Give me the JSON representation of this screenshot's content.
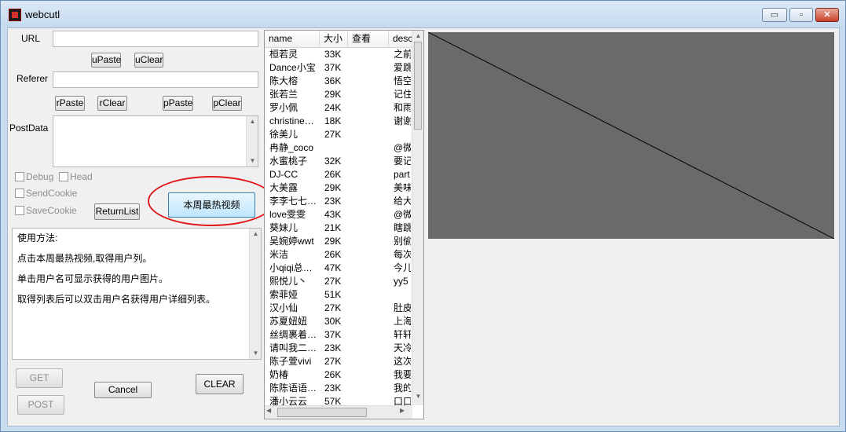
{
  "window": {
    "title": "webcutl"
  },
  "titlebar_buttons": {
    "minimize": "▭",
    "maximize": "▫",
    "close": "✕"
  },
  "form": {
    "url_label": "URL",
    "url_value": "",
    "upaste": "uPaste",
    "uclear": "uClear",
    "referer_label": "Referer",
    "referer_value": "",
    "rpaste": "rPaste",
    "rclear": "rClear",
    "ppaste": "pPaste",
    "pclear": "pClear",
    "postdata_label": "PostData",
    "postdata_value": ""
  },
  "options": {
    "debug": "Debug",
    "head": "Head",
    "sendcookie": "SendCookie",
    "savecookie": "SaveCookie"
  },
  "buttons": {
    "returnlist": "ReturnList",
    "hot_video": "本周最热视频",
    "get": "GET",
    "post": "POST",
    "cancel": "Cancel",
    "clear": "CLEAR"
  },
  "help": {
    "lines": [
      "使用方法:",
      "点击本周最热视频,取得用户列。",
      "单击用户名可显示获得的用户图片。",
      "取得列表后可以双击用户名获得用户详细列表。"
    ]
  },
  "list": {
    "columns": [
      "name",
      "大小",
      "查看",
      "desc"
    ],
    "rows": [
      {
        "name": "桓若灵",
        "size": "33K",
        "view": "",
        "desc": "之前"
      },
      {
        "name": "Dance小宝",
        "size": "37K",
        "view": "",
        "desc": "爱跳"
      },
      {
        "name": "陈大榕",
        "size": "36K",
        "view": "",
        "desc": "悟空"
      },
      {
        "name": "张若兰",
        "size": "29K",
        "view": "",
        "desc": "记住"
      },
      {
        "name": "罗小佩",
        "size": "24K",
        "view": "",
        "desc": "和雨"
      },
      {
        "name": "christine…",
        "size": "18K",
        "view": "",
        "desc": "谢谢"
      },
      {
        "name": "徐美儿",
        "size": "27K",
        "view": "",
        "desc": ""
      },
      {
        "name": "冉静_coco",
        "size": "",
        "view": "",
        "desc": "@微"
      },
      {
        "name": "水蜜桃子",
        "size": "32K",
        "view": "",
        "desc": "要记"
      },
      {
        "name": "DJ-CC",
        "size": "26K",
        "view": "",
        "desc": "part"
      },
      {
        "name": "大美露",
        "size": "29K",
        "view": "",
        "desc": "美味"
      },
      {
        "name": "李李七七…",
        "size": "23K",
        "view": "",
        "desc": "给大"
      },
      {
        "name": "love雯雯",
        "size": "43K",
        "view": "",
        "desc": "@微"
      },
      {
        "name": "葵妹儿",
        "size": "21K",
        "view": "",
        "desc": "瞎跳"
      },
      {
        "name": "吴婉婷wwt",
        "size": "29K",
        "view": "",
        "desc": "别偷"
      },
      {
        "name": "米洁",
        "size": "26K",
        "view": "",
        "desc": "每次"
      },
      {
        "name": "小qiqi总…",
        "size": "47K",
        "view": "",
        "desc": "今儿"
      },
      {
        "name": "熙悦儿丶",
        "size": "27K",
        "view": "",
        "desc": "yy5"
      },
      {
        "name": "索菲娅",
        "size": "51K",
        "view": "",
        "desc": ""
      },
      {
        "name": "汉小仙",
        "size": "27K",
        "view": "",
        "desc": "肚皮"
      },
      {
        "name": "苏夏妞妞",
        "size": "30K",
        "view": "",
        "desc": "上海"
      },
      {
        "name": "丝绸裹着…",
        "size": "37K",
        "view": "",
        "desc": "轩轩"
      },
      {
        "name": "请叫我二…",
        "size": "23K",
        "view": "",
        "desc": "天冷"
      },
      {
        "name": "陈子萱vivi",
        "size": "27K",
        "view": "",
        "desc": "这次"
      },
      {
        "name": "奶椿",
        "size": "26K",
        "view": "",
        "desc": "我要"
      },
      {
        "name": "陈陈语语…",
        "size": "23K",
        "view": "",
        "desc": "我的"
      },
      {
        "name": "潘小云云",
        "size": "57K",
        "view": "",
        "desc": "口口"
      }
    ]
  },
  "colors": {
    "canvas": "#6a6a6a",
    "highlight": "#e01818"
  }
}
